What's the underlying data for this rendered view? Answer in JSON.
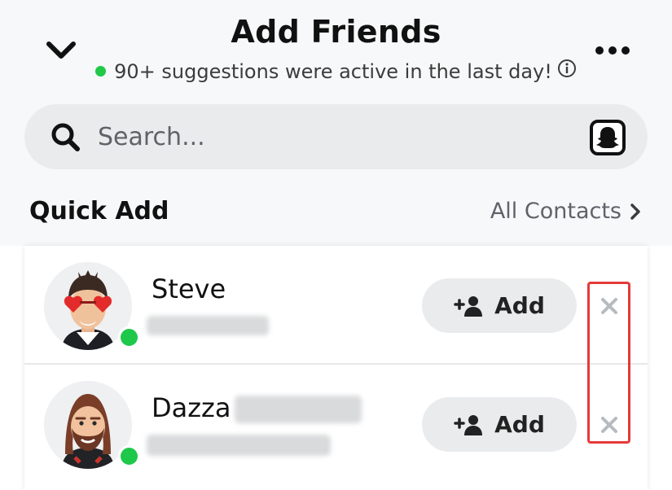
{
  "header": {
    "title": "Add Friends",
    "subtitle": "90+ suggestions were active in the last day!",
    "back_icon": "chevron-down-icon",
    "info_icon": "info-icon",
    "more_icon": "more-dots-icon",
    "status_color": "#21c84a"
  },
  "search": {
    "placeholder": "Search...",
    "value": "",
    "icon": "search-icon",
    "scan_icon": "snapcode-ghost-icon"
  },
  "quick_add": {
    "title": "Quick Add",
    "all_contacts_label": "All Contacts",
    "all_contacts_icon": "chevron-right-icon"
  },
  "suggestions": [
    {
      "name": "Steve",
      "add_label": "Add",
      "online": true,
      "dismiss_icon": "close-icon"
    },
    {
      "name": "Dazza",
      "add_label": "Add",
      "online": true,
      "dismiss_icon": "close-icon"
    }
  ],
  "colors": {
    "accent_online": "#1ec84a",
    "highlight": "#e53a3a",
    "pill_bg": "#e9ebed"
  }
}
